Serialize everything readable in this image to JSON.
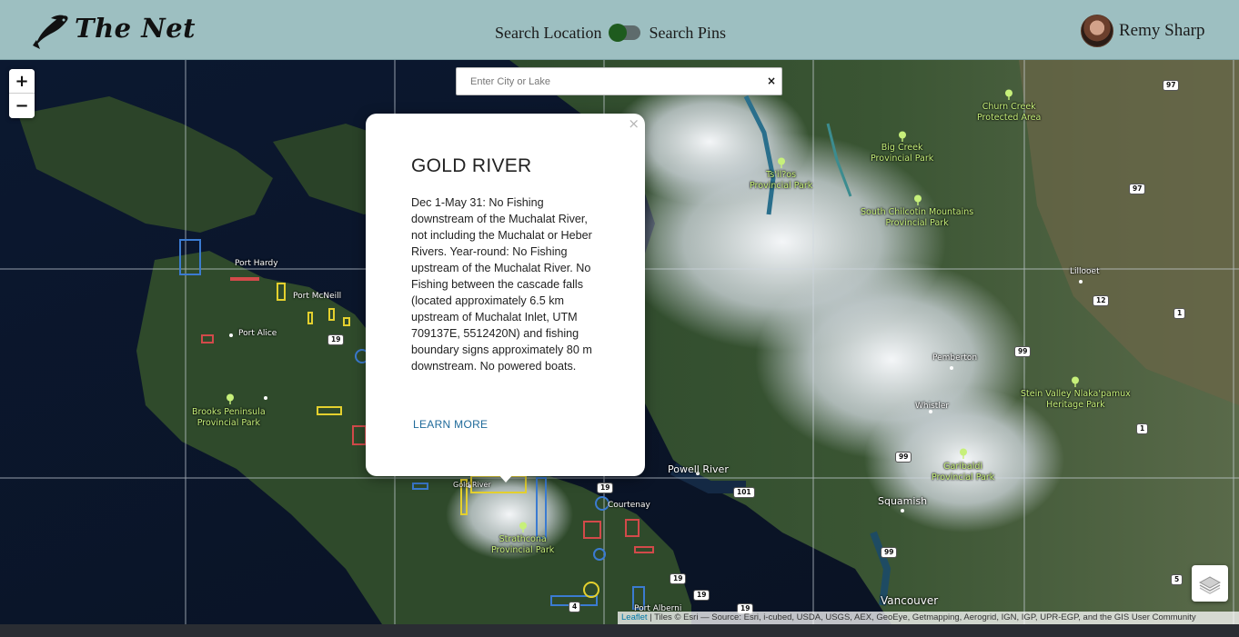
{
  "header": {
    "brand": "The Net",
    "toggle": {
      "left_label": "Search Location",
      "right_label": "Search Pins"
    },
    "user": {
      "name": "Remy Sharp"
    }
  },
  "map": {
    "zoom_in": "+",
    "zoom_out": "−",
    "search": {
      "placeholder": "Enter City or Lake",
      "clear": "×"
    },
    "popup": {
      "close": "×",
      "title": "GOLD RIVER",
      "body": "Dec 1-May 31: No Fishing downstream of the Muchalat River, not including the Muchalat or Heber Rivers. Year-round: No Fishing upstream of the Muchalat River. No Fishing between the cascade falls (located approximately 6.5 km upstream of Muchalat Inlet, UTM 709137E, 5512420N) and fishing boundary signs approximately 80 m downstream. No powered boats.",
      "link": "LEARN MORE"
    },
    "labels": {
      "port_hardy": "Port Hardy",
      "port_mcneill": "Port McNeill",
      "port_alice": "Port Alice",
      "gold_river": "Gold River",
      "courtenay": "Courtenay",
      "powell_river": "Powell River",
      "squamish": "Squamish",
      "vancouver": "Vancouver",
      "pemberton": "Pemberton",
      "whistler": "Whistler",
      "lillooet": "Lillooet",
      "port_alberni": "Port Alberni"
    },
    "parks": {
      "brooks": "Brooks Peninsula\nProvincial Park",
      "strathcona": "Strathcona\nProvincial Park",
      "tsilos": "Ts'il?os\nProvincial Park",
      "big_creek": "Big Creek\nProvincial Park",
      "churn_creek": "Churn Creek\nProtected Area",
      "south_chilcotin": "South Chilcotin Mountains\nProvincial Park",
      "stein_valley": "Stein Valley Nlaka'pamux\nHeritage Park",
      "garibaldi": "Garibaldi\nProvincial Park"
    },
    "shields": {
      "h19a": "19",
      "h19b": "19",
      "h19c": "19",
      "h19d": "19",
      "h19e": "19",
      "h101": "101",
      "h99a": "99",
      "h99b": "99",
      "h99c": "99",
      "h97a": "97",
      "h97b": "97",
      "h12": "12",
      "h1a": "1",
      "h1b": "1",
      "h5": "5",
      "h4": "4"
    },
    "attribution": {
      "leaflet": "Leaflet",
      "text": " | Tiles © Esri — Source: Esri, i-cubed, USDA, USGS, AEX, GeoEye, Getmapping, Aerogrid, IGN, IGP, UPR-EGP, and the GIS User Community"
    }
  }
}
